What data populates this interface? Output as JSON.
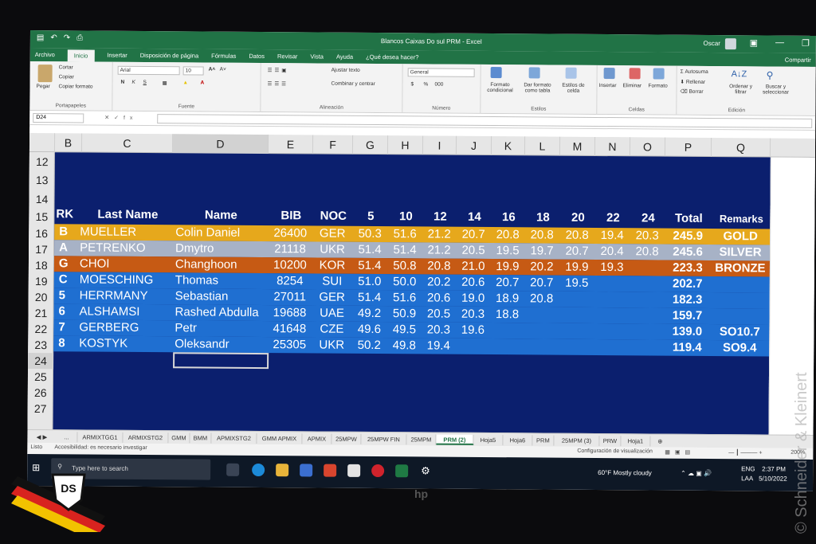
{
  "window": {
    "title": "Blancos Caixas Do sul PRM - Excel",
    "user": "Oscar",
    "share_label": "Compartir"
  },
  "menu_tabs": [
    "Archivo",
    "Inicio",
    "Insertar",
    "Disposición de página",
    "Fórmulas",
    "Datos",
    "Revisar",
    "Vista",
    "Ayuda",
    "¿Qué desea hacer?"
  ],
  "ribbon": {
    "clipboard": {
      "paste": "Pegar",
      "cut": "Cortar",
      "copy": "Copiar",
      "format_painter": "Copiar formato",
      "label": "Portapapeles"
    },
    "font": {
      "name": "Arial",
      "size": "10",
      "bold": "N",
      "italic": "K",
      "underline": "S",
      "label": "Fuente"
    },
    "alignment": {
      "wrap": "Ajustar texto",
      "merge": "Combinar y centrar",
      "label": "Alineación"
    },
    "number": {
      "format": "General",
      "currency": "$",
      "percent": "%",
      "thousands": "000",
      "label": "Número"
    },
    "styles": {
      "conditional": "Formato condicional",
      "as_table": "Dar formato como tabla",
      "cell_styles": "Estilos de celda",
      "label": "Estilos"
    },
    "cells": {
      "insert": "Insertar",
      "delete": "Eliminar",
      "format": "Formato",
      "label": "Celdas"
    },
    "editing": {
      "autosum": "Autosuma",
      "fill": "Rellenar",
      "clear": "Borrar",
      "sort": "Ordenar y filtrar",
      "find": "Buscar y seleccionar",
      "label": "Edición"
    }
  },
  "formula_bar": {
    "name_box": "D24",
    "fx": "fx",
    "value": ""
  },
  "column_headers": [
    "B",
    "C",
    "D",
    "E",
    "F",
    "G",
    "H",
    "I",
    "J",
    "K",
    "L",
    "M",
    "N",
    "O",
    "P",
    "Q",
    "R"
  ],
  "row_numbers": [
    "12",
    "13",
    "14",
    "15",
    "16",
    "17",
    "18",
    "19",
    "20",
    "21",
    "22",
    "23",
    "24",
    "25",
    "26",
    "27"
  ],
  "table": {
    "headers": [
      "RK",
      "Last Name",
      "Name",
      "BIB",
      "NOC",
      "5",
      "10",
      "12",
      "14",
      "16",
      "18",
      "20",
      "22",
      "24",
      "Total",
      "Remarks"
    ],
    "rows": [
      {
        "rk": "B",
        "last": "MUELLER",
        "first": "Colin Daniel",
        "bib": "26400",
        "noc": "GER",
        "shots": [
          "50.3",
          "51.6",
          "21.2",
          "20.7",
          "20.8",
          "20.8",
          "20.8",
          "19.4",
          "20.3"
        ],
        "total": "245.9",
        "remark": "GOLD",
        "bg": "#e6a81c",
        "fg": "#ffffff"
      },
      {
        "rk": "A",
        "last": "PETRENKO",
        "first": "Dmytro",
        "bib": "21118",
        "noc": "UKR",
        "shots": [
          "51.4",
          "51.4",
          "21.2",
          "20.5",
          "19.5",
          "19.7",
          "20.7",
          "20.4",
          "20.8"
        ],
        "total": "245.6",
        "remark": "SILVER",
        "bg": "#a7b2c6",
        "fg": "#ffffff"
      },
      {
        "rk": "G",
        "last": "CHOI",
        "first": "Changhoon",
        "bib": "10200",
        "noc": "KOR",
        "shots": [
          "51.4",
          "50.8",
          "20.8",
          "21.0",
          "19.9",
          "20.2",
          "19.9",
          "19.3",
          ""
        ],
        "total": "223.3",
        "remark": "BRONZE",
        "bg": "#c65a14",
        "fg": "#ffffff"
      },
      {
        "rk": "C",
        "last": "MOESCHING",
        "first": "Thomas",
        "bib": "8254",
        "noc": "SUI",
        "shots": [
          "51.0",
          "50.0",
          "20.2",
          "20.6",
          "20.7",
          "20.7",
          "19.5",
          "",
          ""
        ],
        "total": "202.7",
        "remark": "",
        "bg": "#1f6fd1",
        "fg": "#ffffff"
      },
      {
        "rk": "5",
        "last": "HERRMANY",
        "first": "Sebastian",
        "bib": "27011",
        "noc": "GER",
        "shots": [
          "51.4",
          "51.6",
          "20.6",
          "19.0",
          "18.9",
          "20.8",
          "",
          "",
          ""
        ],
        "total": "182.3",
        "remark": "",
        "bg": "#1f6fd1",
        "fg": "#ffffff"
      },
      {
        "rk": "6",
        "last": "ALSHAMSI",
        "first": "Rashed Abdulla",
        "bib": "19688",
        "noc": "UAE",
        "shots": [
          "49.2",
          "50.9",
          "20.5",
          "20.3",
          "18.8",
          "",
          "",
          "",
          ""
        ],
        "total": "159.7",
        "remark": "",
        "bg": "#1f6fd1",
        "fg": "#ffffff"
      },
      {
        "rk": "7",
        "last": "GERBERG",
        "first": "Petr",
        "bib": "41648",
        "noc": "CZE",
        "shots": [
          "49.6",
          "49.5",
          "20.3",
          "19.6",
          "",
          "",
          "",
          "",
          ""
        ],
        "total": "139.0",
        "remark": "SO10.7",
        "bg": "#1f6fd1",
        "fg": "#ffffff"
      },
      {
        "rk": "8",
        "last": "KOSTYK",
        "first": "Oleksandr",
        "bib": "25305",
        "noc": "UKR",
        "shots": [
          "50.2",
          "49.8",
          "19.4",
          "",
          "",
          "",
          "",
          "",
          ""
        ],
        "total": "119.4",
        "remark": "SO9.4",
        "bg": "#1f6fd1",
        "fg": "#ffffff"
      }
    ]
  },
  "sheet_tabs": [
    "...",
    "ARMIXTGG1",
    "ARMIXSTG2",
    "GMM",
    "BMM",
    "APMIXSTG2",
    "GMM APMIX",
    "APMIX",
    "25MPW",
    "25MPW FIN",
    "25MPM",
    "PRM (2)",
    "Hoja5",
    "Hoja6",
    "PRM",
    "25MPM (3)",
    "PRW",
    "Hoja1"
  ],
  "active_sheet": "PRM (2)",
  "status": {
    "ready": "Listo",
    "accessibility": "Accesibilidad: es necesario investigar",
    "view_settings": "Configuración de visualización",
    "zoom": "200%"
  },
  "taskbar": {
    "search_placeholder": "Type here to search",
    "weather": "60°F Mostly cloudy",
    "lang1": "ENG",
    "lang2": "LAA",
    "time": "2:37 PM",
    "date": "5/10/2022"
  },
  "watermark": "© Schneider & Kleinert",
  "monitor_brand": "hp",
  "colors": {
    "excel_green": "#217346",
    "sheet_bg": "#0b1f6e",
    "gold": "#e6a81c",
    "silver": "#a7b2c6",
    "bronze": "#c65a14",
    "blue_row": "#1f6fd1"
  }
}
